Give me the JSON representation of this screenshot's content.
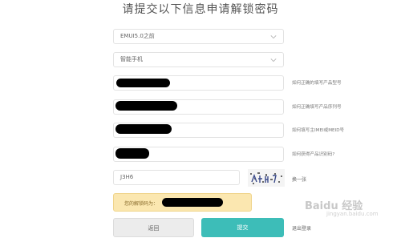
{
  "page": {
    "title": "请提交以下信息申请解锁密码"
  },
  "form": {
    "emui_version": {
      "value": "EMUI5.0之前"
    },
    "product_type": {
      "value": "智能手机"
    },
    "hints": {
      "model": "如何正确的填写产品型号",
      "serial": "如何正确填写产品序列号",
      "imei": "如何填写主IMEI或MEID号",
      "code": "如何获得产品识别码?"
    },
    "captcha": {
      "value": "J3H6",
      "refresh": "换一张"
    },
    "result": {
      "label": "您的解锁码为："
    },
    "buttons": {
      "back": "返回",
      "submit": "提交",
      "login": "退出登录"
    }
  },
  "watermark": {
    "brand": "Baidu 经验",
    "url": "jingyan.baidu.com"
  },
  "colors": {
    "accent": "#3dbdb8",
    "result_bg": "#fbe7b0",
    "redaction": "#000000"
  }
}
